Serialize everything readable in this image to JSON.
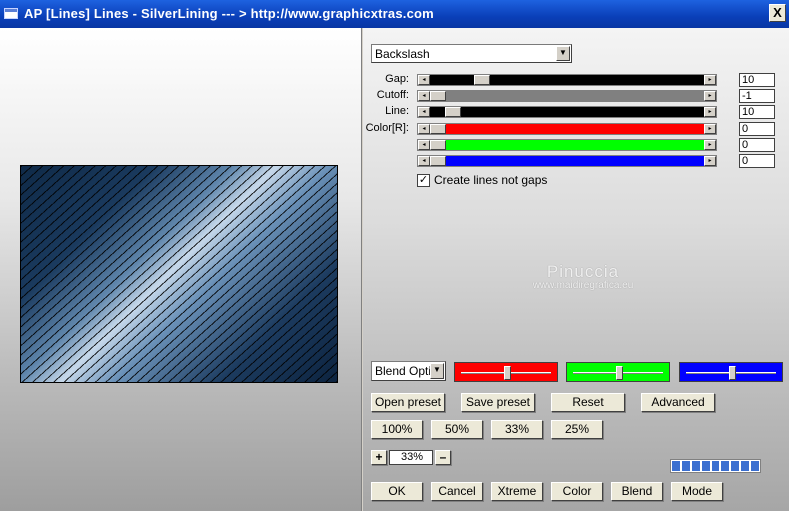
{
  "window": {
    "title": "AP [Lines]  Lines - SilverLining     --- > http://www.graphicxtras.com",
    "close_label": "X"
  },
  "pattern_select": {
    "value": "Backslash"
  },
  "sliders": [
    {
      "label": "Gap:",
      "value": "10",
      "level": 0.17,
      "track": "#000000"
    },
    {
      "label": "Cutoff:",
      "value": "-1",
      "level": 0.0,
      "track": "#808080"
    },
    {
      "label": "Line:",
      "value": "10",
      "level": 0.06,
      "track": "#000000"
    },
    {
      "label": "Color[R]:",
      "value": "0",
      "level": 0.0,
      "track": "#ff0000"
    },
    {
      "label": "",
      "value": "0",
      "level": 0.0,
      "track": "#00ff00"
    },
    {
      "label": "",
      "value": "0",
      "level": 0.0,
      "track": "#0000ff"
    }
  ],
  "create_lines": {
    "label": "Create lines not gaps",
    "checked": "✓"
  },
  "watermark": {
    "line1": "Pinuccia",
    "line2": "www.maidiregrafica.eu"
  },
  "blend_select": {
    "value": "Blend Optio"
  },
  "color_sliders": [
    {
      "color": "#ff0000",
      "level": 0.5
    },
    {
      "color": "#00ff00",
      "level": 0.5
    },
    {
      "color": "#0000ff",
      "level": 0.5
    }
  ],
  "buttons": {
    "open_preset": "Open preset",
    "save_preset": "Save preset",
    "reset": "Reset",
    "advanced": "Advanced",
    "zoom_100": "100%",
    "zoom_50": "50%",
    "zoom_33": "33%",
    "zoom_25": "25%",
    "ok": "OK",
    "cancel": "Cancel",
    "xtreme": "Xtreme",
    "color": "Color",
    "blend": "Blend",
    "mode": "Mode"
  },
  "zoom": {
    "plus": "+",
    "minus": "–",
    "value": "33%"
  },
  "progress": {
    "segments": 9,
    "filled": 9
  }
}
